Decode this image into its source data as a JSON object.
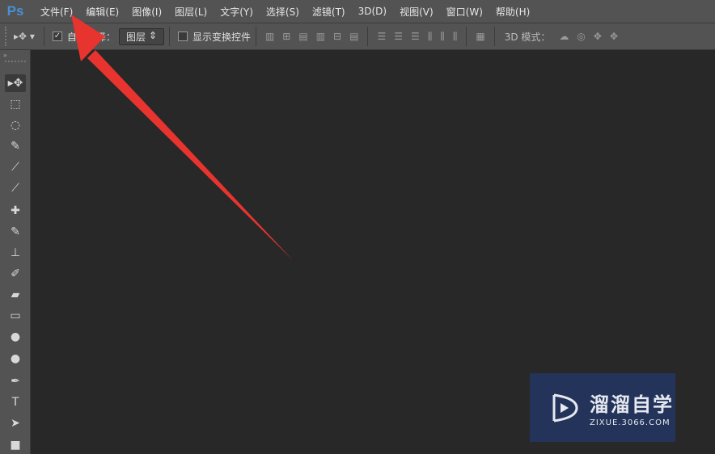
{
  "app": {
    "logo": "Ps"
  },
  "menu": [
    "文件(F)",
    "编辑(E)",
    "图像(I)",
    "图层(L)",
    "文字(Y)",
    "选择(S)",
    "滤镜(T)",
    "3D(D)",
    "视图(V)",
    "窗口(W)",
    "帮助(H)"
  ],
  "options": {
    "auto_select_label": "自动选择：",
    "auto_select_checked": true,
    "auto_select_value": "图层",
    "show_transform_label": "显示变换控件",
    "show_transform_checked": false,
    "mode_label": "3D 模式："
  },
  "tools": [
    "move",
    "marquee",
    "lasso",
    "quick-selection",
    "crop",
    "eyedropper",
    "healing-brush",
    "brush",
    "clone-stamp",
    "history-brush",
    "eraser",
    "gradient",
    "blur",
    "dodge",
    "pen",
    "type",
    "path-selection",
    "rectangle"
  ],
  "watermark": {
    "title": "溜溜自学",
    "url": "ZIXUE.3066.COM"
  },
  "annotation_color": "#e8342f"
}
